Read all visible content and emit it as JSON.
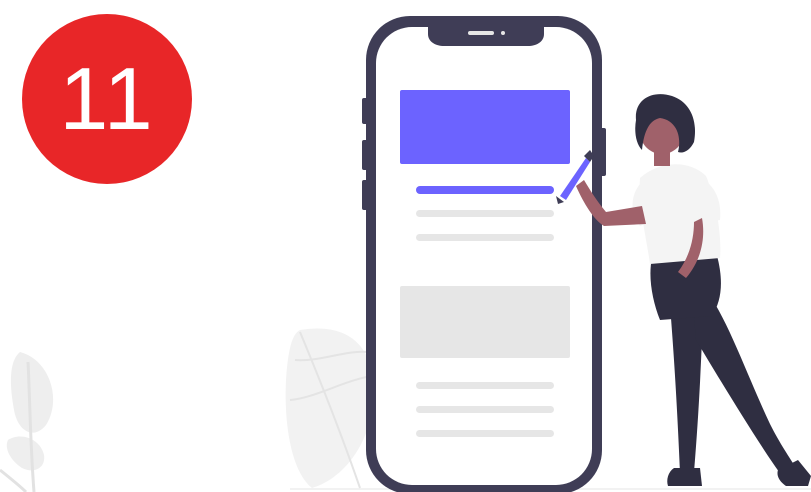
{
  "badge": {
    "number": "11",
    "color": "#e82628"
  },
  "colors": {
    "accent": "#6c63ff",
    "phone_frame": "#3f3d56",
    "placeholder": "#e6e6e6",
    "leaf": "#f2f2f2",
    "skin": "#a0616a",
    "hair": "#2f2e41",
    "shirt": "#f4f4f4"
  },
  "icons": {
    "phone": "smartphone-illustration",
    "person": "woman-with-stylus-illustration",
    "leaves": "decorative-leaf-icon"
  }
}
